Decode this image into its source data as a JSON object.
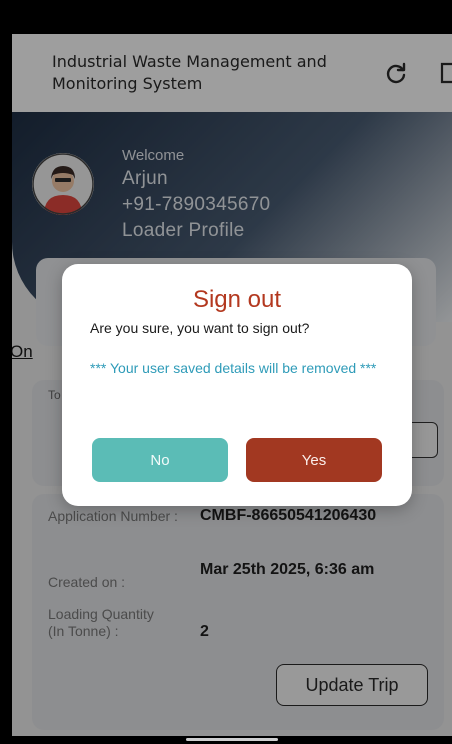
{
  "app": {
    "title": "Industrial Waste Management and Monitoring System"
  },
  "icons": {
    "refresh": "refresh-icon",
    "logout": "logout-icon",
    "avatar": "person-avatar-icon"
  },
  "profile": {
    "welcome_label": "Welcome",
    "name": "Arjun",
    "phone": "+91-7890345670",
    "role": "Loader Profile"
  },
  "section": {
    "title": "On"
  },
  "trip_card": {
    "label": "To"
  },
  "application": {
    "number_label": "Application Number :",
    "number_value": "CMBF-86650541206430",
    "created_label": "Created on :",
    "created_value": "Mar 25th 2025, 6:36 am",
    "quantity_label": "Loading Quantity (In Tonne) :",
    "quantity_value": "2",
    "update_button": "Update Trip"
  },
  "dialog": {
    "title": "Sign out",
    "message": "Are you sure, you want to sign out?",
    "warning": "*** Your user saved details will be removed ***",
    "no_label": "No",
    "yes_label": "Yes"
  },
  "colors": {
    "accent_red": "#a23821",
    "accent_teal": "#5bbcb6",
    "warning_text": "#2e9bb8",
    "header_dark": "#1f2f45"
  }
}
